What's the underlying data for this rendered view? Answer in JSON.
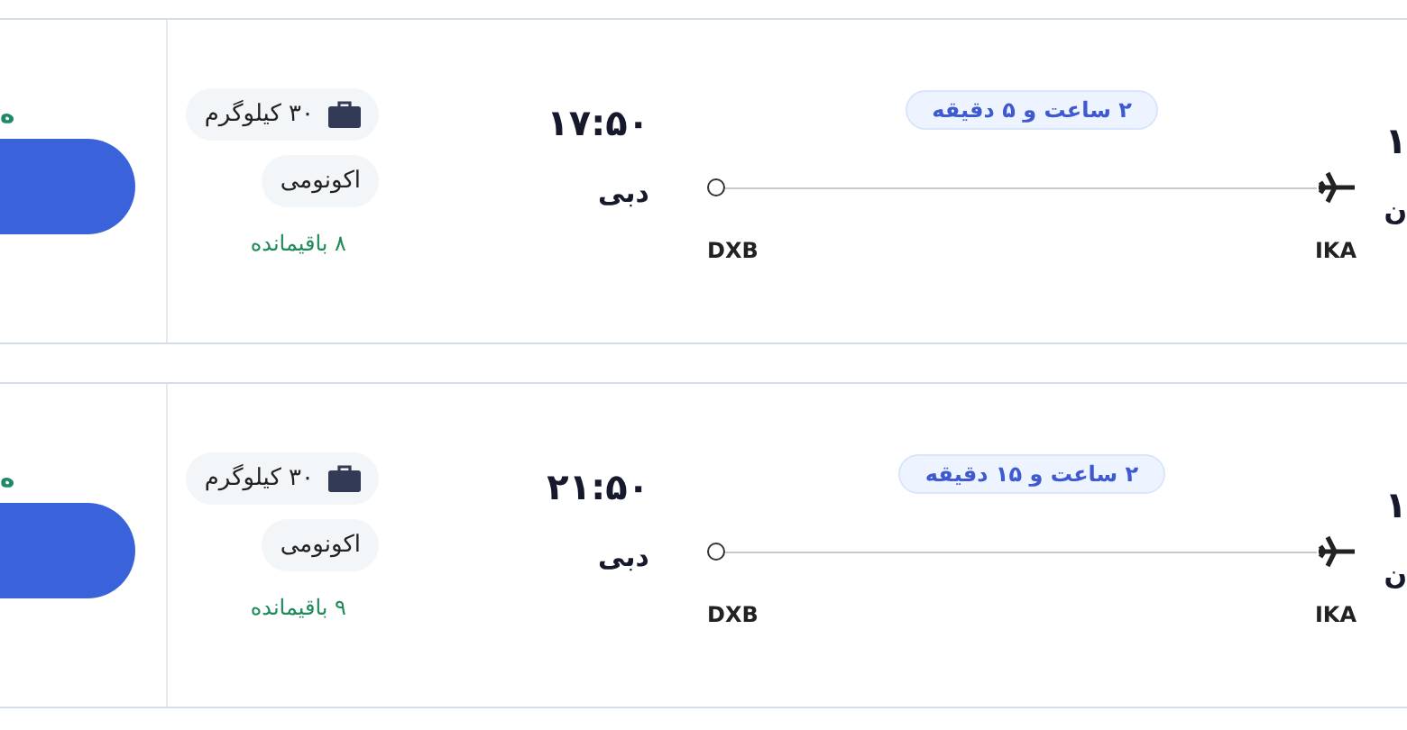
{
  "flights": [
    {
      "price": "ه",
      "departure_time": "۱",
      "departure_city": "ن",
      "duration": "۲ ساعت و ۵ دقیقه",
      "origin_code": "IKA",
      "destination_code": "DXB",
      "arrival_time": "۱۷:۵۰",
      "arrival_city": "دبی",
      "baggage": "۳۰ کیلوگرم",
      "cabin": "اکونومی",
      "seats_left": "۸ باقیمانده"
    },
    {
      "price": "ه",
      "departure_time": "۱",
      "departure_city": "ن",
      "duration": "۲ ساعت و ۱۵ دقیقه",
      "origin_code": "IKA",
      "destination_code": "DXB",
      "arrival_time": "۲۱:۵۰",
      "arrival_city": "دبی",
      "baggage": "۳۰ کیلوگرم",
      "cabin": "اکونومی",
      "seats_left": "۹ باقیمانده"
    }
  ]
}
